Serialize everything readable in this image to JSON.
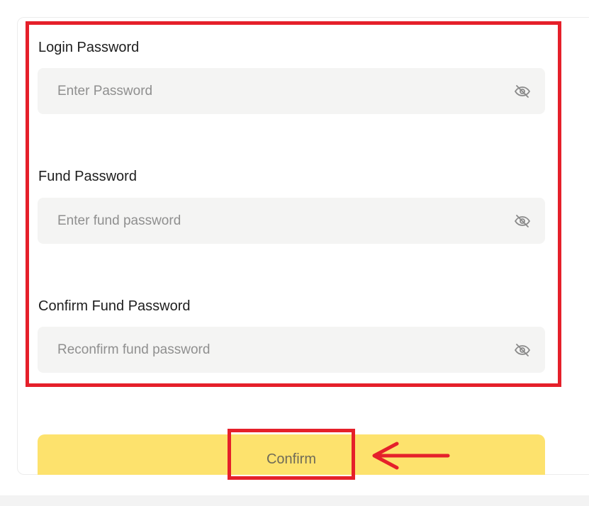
{
  "form": {
    "fields": [
      {
        "label": "Login Password",
        "placeholder": "Enter Password",
        "value": "",
        "icon": "eye-off-icon"
      },
      {
        "label": "Fund Password",
        "placeholder": "Enter fund password",
        "value": "",
        "icon": "eye-off-icon"
      },
      {
        "label": "Confirm Fund Password",
        "placeholder": "Reconfirm fund password",
        "value": "",
        "icon": "eye-off-icon"
      }
    ],
    "confirm_label": "Confirm"
  },
  "colors": {
    "accent_button": "#fde26d",
    "annotation_red": "#e5202a",
    "field_background": "#f4f4f3"
  }
}
